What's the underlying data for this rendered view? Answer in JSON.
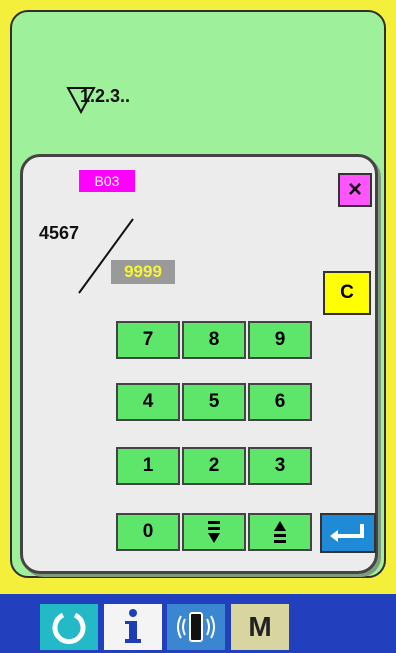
{
  "header": {
    "counter_icon_text": "1.2.3.."
  },
  "dialog": {
    "tag": "B03",
    "close_label": "×",
    "current_value": "4567",
    "total_value": "9999",
    "clear_label": "C"
  },
  "keypad": {
    "keys": [
      "7",
      "8",
      "9",
      "4",
      "5",
      "6",
      "1",
      "2",
      "3",
      "0"
    ]
  },
  "taskbar": {
    "mode_label": "M"
  },
  "colors": {
    "background": "#f4ef3a",
    "panel": "#9ef09a",
    "tag": "#ff00ff",
    "key": "#5ee66a",
    "clear": "#ffff00",
    "taskbar": "#223fbd"
  },
  "icons": [
    "counter-icon",
    "close-icon",
    "down-arrow-icon",
    "up-arrow-icon",
    "enter-icon",
    "home-icon",
    "info-icon",
    "communication-icon"
  ]
}
